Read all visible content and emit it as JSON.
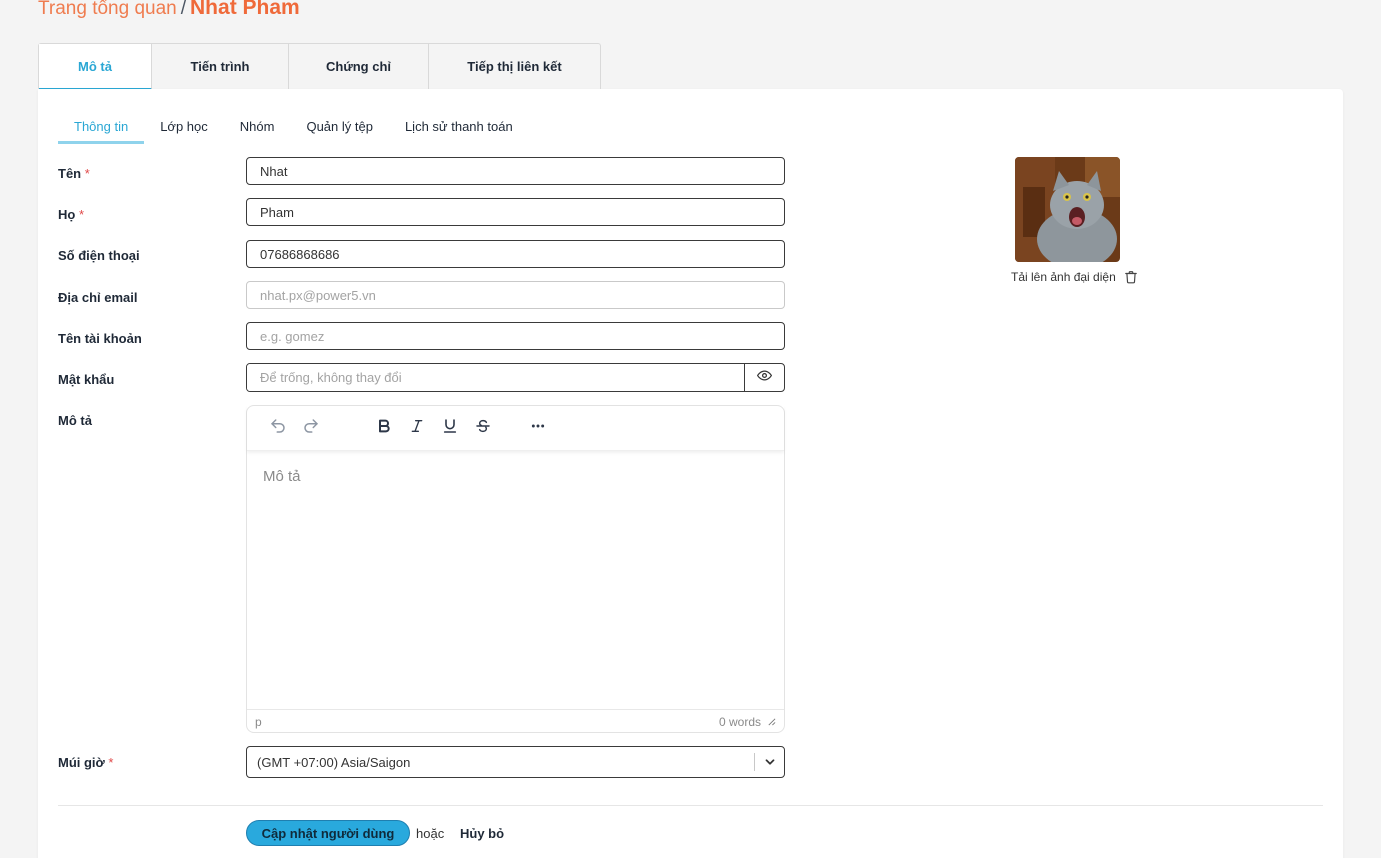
{
  "breadcrumb": {
    "root": "Trang tổng quan",
    "separator": "/",
    "current": "Nhat Pham"
  },
  "top_tabs": [
    {
      "label": "Mô tả"
    },
    {
      "label": "Tiến trình"
    },
    {
      "label": "Chứng chỉ"
    },
    {
      "label": "Tiếp thị liên kết"
    }
  ],
  "sub_tabs": [
    {
      "label": "Thông tin"
    },
    {
      "label": "Lớp học"
    },
    {
      "label": "Nhóm"
    },
    {
      "label": "Quản lý tệp"
    },
    {
      "label": "Lịch sử thanh toán"
    }
  ],
  "form": {
    "first_name": {
      "label": "Tên",
      "required_mark": "*",
      "value": "Nhat"
    },
    "last_name": {
      "label": "Họ",
      "required_mark": "*",
      "value": "Pham"
    },
    "phone": {
      "label": "Số điện thoại",
      "value": "07686868686"
    },
    "email": {
      "label": "Địa chỉ email",
      "placeholder": "nhat.px@power5.vn"
    },
    "username": {
      "label": "Tên tài khoản",
      "placeholder": "e.g. gomez"
    },
    "password": {
      "label": "Mật khẩu",
      "placeholder": "Để trống, không thay đổi"
    },
    "description": {
      "label": "Mô tả",
      "placeholder": "Mô tả",
      "path": "p",
      "word_count": "0 words"
    },
    "timezone": {
      "label": "Múi giờ",
      "required_mark": "*",
      "value": "(GMT +07:00) Asia/Saigon"
    }
  },
  "actions": {
    "submit": "Cập nhật người dùng",
    "or": "hoặc",
    "cancel": "Hủy bỏ"
  },
  "avatar": {
    "upload_label": "Tải lên ảnh đại diện"
  },
  "colors": {
    "accent": "#2aa7d4",
    "brand_orange": "#ef6a3a",
    "button": "#29a9dd",
    "required": "#e04848"
  }
}
